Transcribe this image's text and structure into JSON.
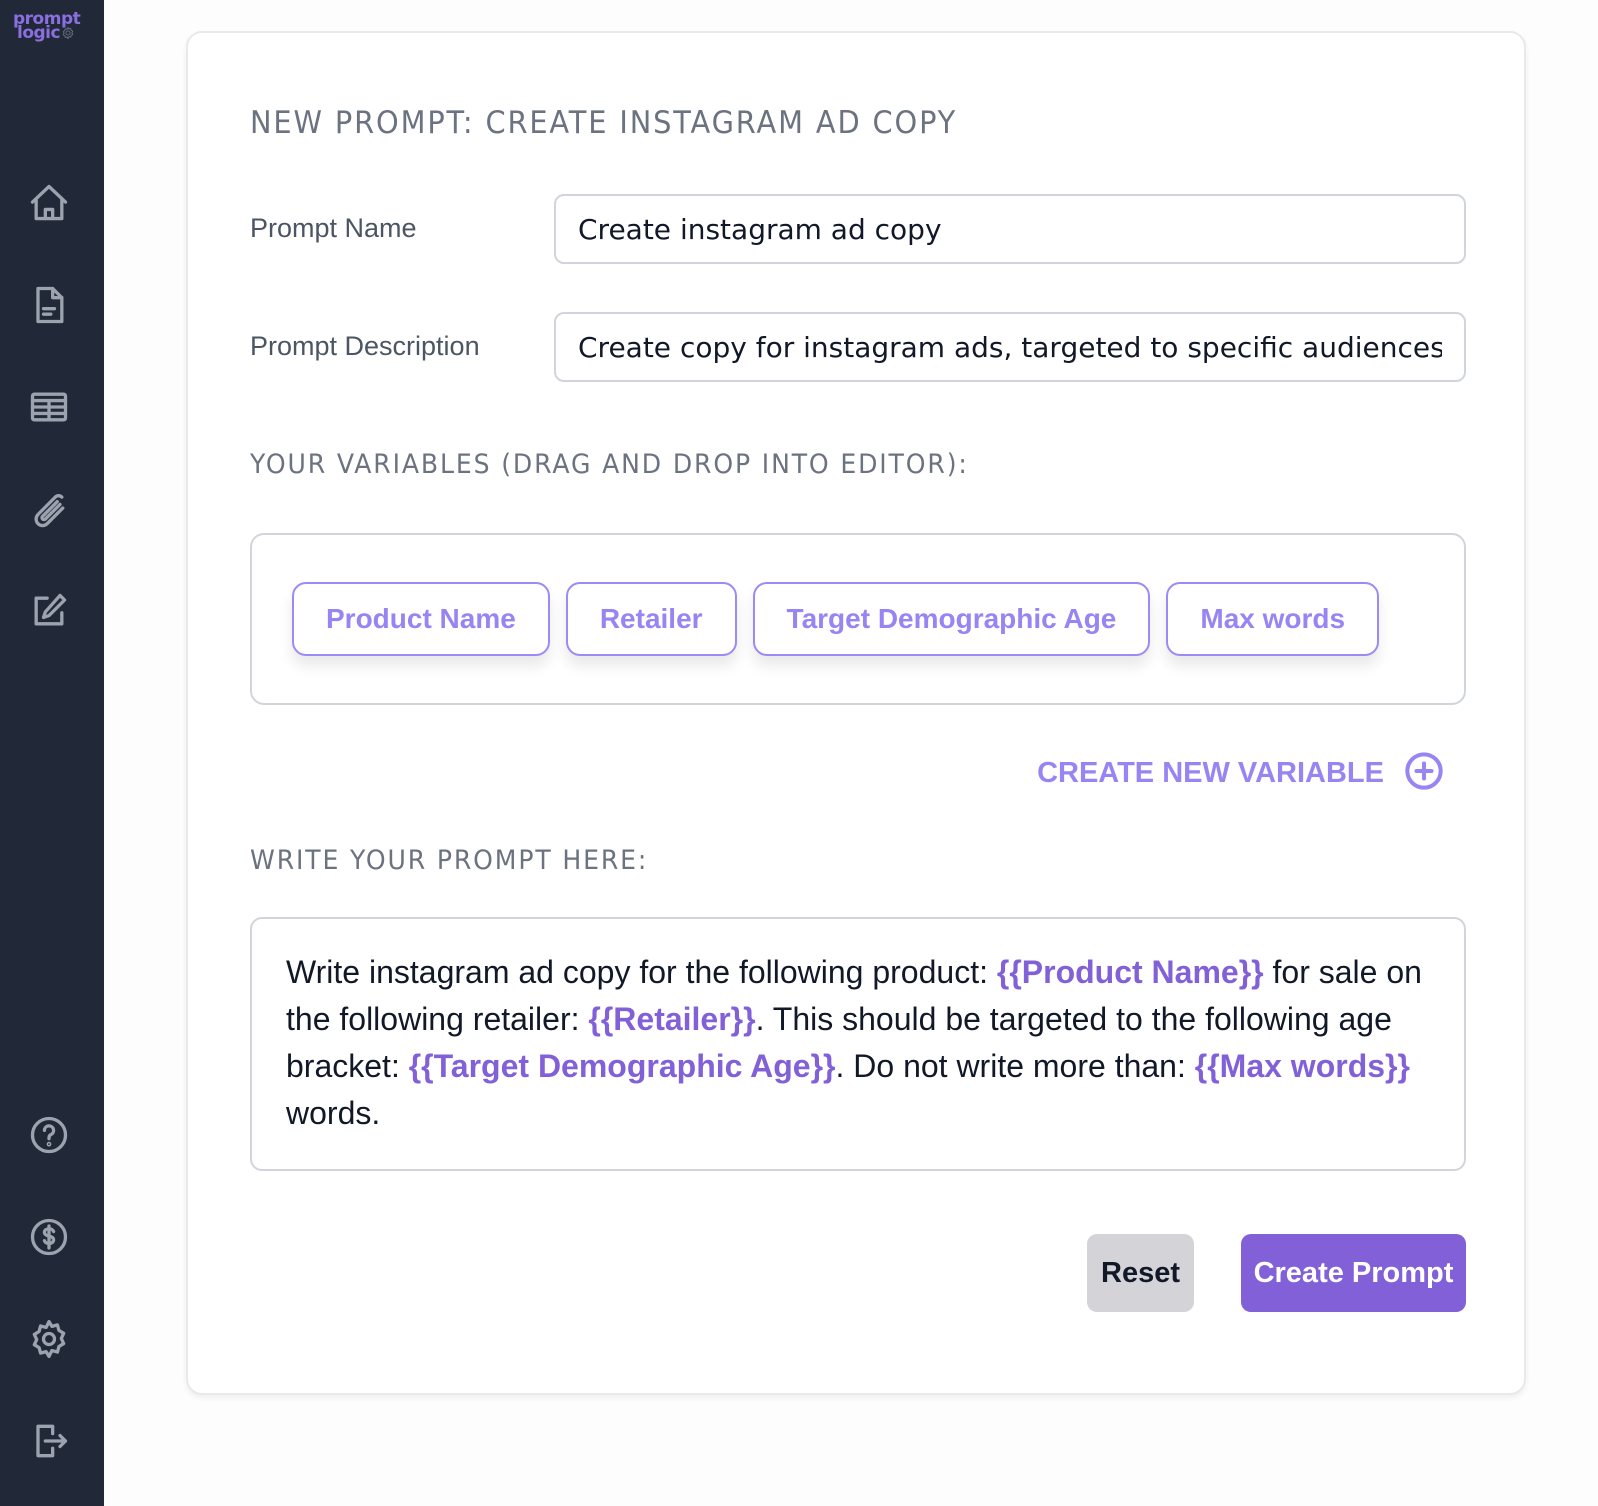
{
  "app": {
    "logo_line1": "prompt",
    "logo_line2": "logic"
  },
  "sidebar": {
    "top_items": [
      {
        "name": "home",
        "icon": "home-icon"
      },
      {
        "name": "documents",
        "icon": "document-icon"
      },
      {
        "name": "table",
        "icon": "table-icon"
      },
      {
        "name": "attachments",
        "icon": "paperclip-icon"
      },
      {
        "name": "edit",
        "icon": "edit-icon"
      }
    ],
    "bottom_items": [
      {
        "name": "help",
        "icon": "help-icon"
      },
      {
        "name": "billing",
        "icon": "dollar-icon"
      },
      {
        "name": "settings",
        "icon": "gear-icon"
      },
      {
        "name": "logout",
        "icon": "logout-icon"
      }
    ]
  },
  "form": {
    "title": "NEW PROMPT: CREATE INSTAGRAM AD COPY",
    "prompt_name_label": "Prompt Name",
    "prompt_name_value": "Create instagram ad copy",
    "prompt_description_label": "Prompt Description",
    "prompt_description_value": "Create copy for instagram ads, targeted to specific audiences",
    "variables_heading": "YOUR VARIABLES (DRAG AND DROP INTO EDITOR):",
    "variables": [
      "Product Name",
      "Retailer",
      "Target Demographic Age",
      "Max words"
    ],
    "create_variable_label": "CREATE NEW VARIABLE",
    "editor_heading": "WRITE YOUR PROMPT HERE:",
    "editor_segments": [
      {
        "text": "Write instagram ad copy for the following product: ",
        "var": false
      },
      {
        "text": "{{Product Name}}",
        "var": true
      },
      {
        "text": " for sale on the following retailer: ",
        "var": false
      },
      {
        "text": "{{Retailer}}",
        "var": true
      },
      {
        "text": ". This should be targeted to the following age bracket: ",
        "var": false
      },
      {
        "text": "{{Target Demographic Age}}",
        "var": true
      },
      {
        "text": ". Do not write more than: ",
        "var": false
      },
      {
        "text": "{{Max words}}",
        "var": true
      },
      {
        "text": " words.",
        "var": false
      }
    ],
    "reset_label": "Reset",
    "create_label": "Create Prompt"
  },
  "colors": {
    "sidebar_bg": "#212837",
    "accent": "#8160d8",
    "chip_text": "#9685f2"
  }
}
